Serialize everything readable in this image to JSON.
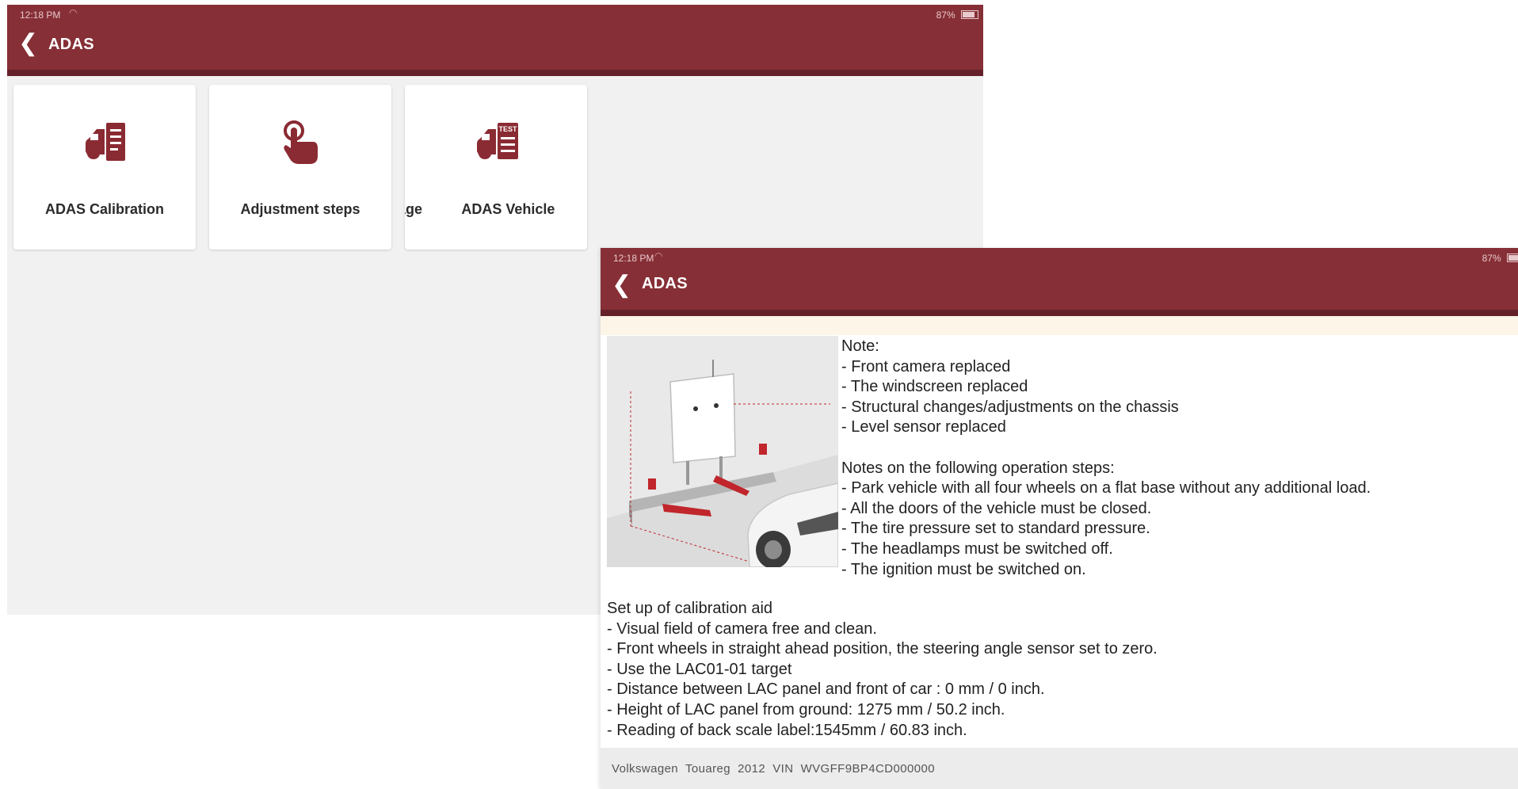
{
  "screen1": {
    "status": {
      "time": "12:18 PM",
      "battery": "87%"
    },
    "header": {
      "back_icon": "chevron-left-icon",
      "title": "ADAS"
    },
    "tiles": [
      {
        "label": "ADAS Calibration",
        "icon": "car-document-icon"
      },
      {
        "label": "Adjustment steps",
        "icon": "tap-hand-icon"
      },
      {
        "label": "Coverage          ADAS Vehicle",
        "icon": "car-test-document-icon"
      }
    ]
  },
  "screen2": {
    "status": {
      "time": "12:18 PM",
      "battery": "87%"
    },
    "header": {
      "back_icon": "chevron-left-icon",
      "title": "ADAS"
    },
    "notes": [
      "Note:",
      "- Front camera replaced",
      "- The windscreen replaced",
      "- Structural changes/adjustments on the chassis",
      "- Level sensor replaced",
      "",
      "Notes on the following operation steps:",
      "- Park vehicle with all four wheels on a flat base without any additional load.",
      "- All the doors of the vehicle must be closed.",
      "- The tire pressure set to standard pressure.",
      "- The headlamps must be switched off.",
      "- The ignition must be switched on."
    ],
    "setup": [
      "Set up of calibration aid",
      "- Visual field of camera free and clean.",
      "- Front wheels in straight ahead position, the steering angle sensor set to zero.",
      "- Use the LAC01-01 target",
      "- Distance between LAC panel and front of car : 0 mm / 0 inch.",
      "- Height of LAC panel from ground: 1275 mm / 50.2 inch.",
      "- Reading of back scale label:1545mm / 60.83 inch."
    ],
    "footer": {
      "make": "Volkswagen",
      "model": "Touareg",
      "year": "2012",
      "vin_label": "VIN",
      "vin": "WVGFF9BP4CD000000"
    }
  },
  "colors": {
    "header": "#862f36",
    "header_shadow": "#65212a",
    "icon": "#8a2a32",
    "background": "#f1f1f1",
    "footer": "#ececec"
  }
}
